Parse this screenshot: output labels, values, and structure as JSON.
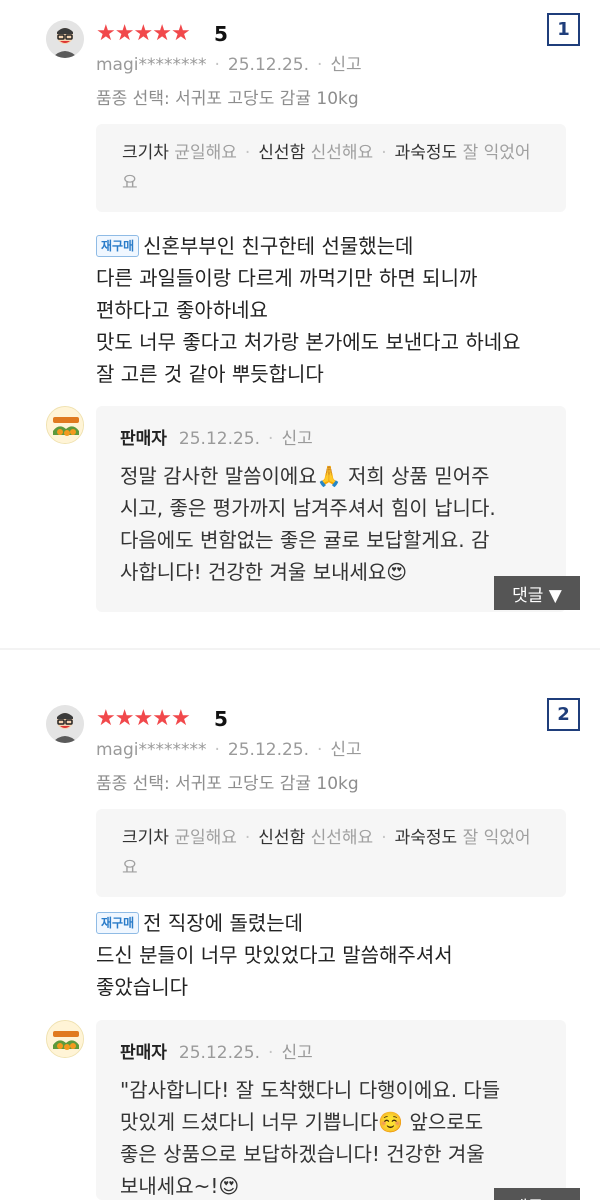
{
  "reviews": [
    {
      "index": "1",
      "rating_score": "5",
      "rating_stars": 5,
      "user": "magi********",
      "date": "25.12.25.",
      "report_label": "신고",
      "option": "품종 선택: 서귀포 고당도 감귤 10kg",
      "attributes": [
        {
          "key": "크기차",
          "value": "균일해요"
        },
        {
          "key": "신선함",
          "value": "신선해요"
        },
        {
          "key": "과숙정도",
          "value": "잘 익었어요"
        }
      ],
      "repurchase_badge": "재구매",
      "body_lines": [
        "신혼부부인 친구한테 선물했는데",
        "다른 과일들이랑 다르게 까먹기만 하면 되니까",
        "편하다고 좋아하네요",
        "맛도 너무 좋다고 처가랑 본가에도 보낸다고 하네요",
        "잘 고른 것 같아 뿌듯합니다"
      ],
      "reply": {
        "name": "판매자",
        "date": "25.12.25.",
        "report_label": "신고",
        "lines": [
          "정말 감사한 말씀이에요🙏 저희 상품 믿어주",
          "시고, 좋은 평가까지 남겨주셔서 힘이 납니다.",
          "다음에도 변함없는 좋은 귤로 보답할게요. 감",
          "사합니다! 건강한 겨울 보내세요😍"
        ]
      },
      "comment_button": "댓글 ▼"
    },
    {
      "index": "2",
      "rating_score": "5",
      "rating_stars": 5,
      "user": "magi********",
      "date": "25.12.25.",
      "report_label": "신고",
      "option": "품종 선택: 서귀포 고당도 감귤 10kg",
      "attributes": [
        {
          "key": "크기차",
          "value": "균일해요"
        },
        {
          "key": "신선함",
          "value": "신선해요"
        },
        {
          "key": "과숙정도",
          "value": "잘 익었어요"
        }
      ],
      "repurchase_badge": "재구매",
      "body_lines": [
        "전 직장에 돌렸는데",
        "드신 분들이 너무 맛있었다고 말씀해주셔서",
        "좋았습니다"
      ],
      "reply": {
        "name": "판매자",
        "date": "25.12.25.",
        "report_label": "신고",
        "lines": [
          "\"감사합니다! 잘 도착했다니 다행이에요. 다들",
          "맛있게 드셨다니 너무 기쁩니다☺️ 앞으로도",
          "좋은 상품으로 보답하겠습니다! 건강한 겨울",
          "보내세요~!😍"
        ]
      },
      "comment_button": "댓글 ▼"
    }
  ],
  "colors": {
    "star": "#f1484b",
    "badge_border": "#1f3e7b",
    "repurchase": "#2a7cc9",
    "box_bg": "#f6f6f6"
  },
  "icons": {
    "avatar": "user-avatar-icon",
    "seller_logo": "seller-logo-icon",
    "star": "star-icon"
  }
}
